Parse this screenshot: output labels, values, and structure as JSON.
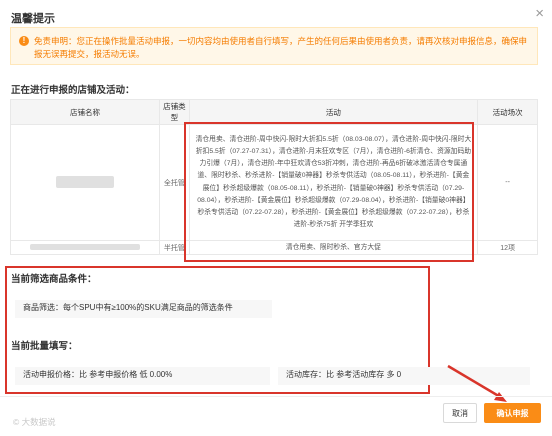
{
  "dialog": {
    "title": "温馨提示",
    "close_label": "×"
  },
  "warning": {
    "icon": "!",
    "text": "免责申明：您正在操作批量活动申报，一切内容均由使用者自行填写，产生的任何后果由使用者负责，请再次核对申报信息，确保申报无误再提交，报活动无误。"
  },
  "shops_section": {
    "title": "正在进行申报的店铺及活动："
  },
  "table": {
    "headers": [
      "店铺名称",
      "店铺类型",
      "活动",
      "活动场次"
    ],
    "rows": [
      {
        "type": "全托管",
        "activity": "清仓甩卖、清仓进阶-周中快闪-限时大折扣5.5折（08.03-08.07），清仓进阶-周中快闪-限时大折扣5.5折（07.27-07.31），清仓进阶-月末狂欢专区（7月），清仓进阶-6折清仓、资源加码助力引爆（7月），清仓进阶-年中狂欢清仓53折冲刺，清仓进阶-再品6折破冰激活清仓专属通道、限时秒杀、秒杀进阶-【销量破0神器】秒杀专供活动（08.05-08.11），秒杀进阶-【黄金展位】秒杀超级爆款（08.05-08.11），秒杀进阶-【销量破0神器】秒杀专供活动（07.29-08.04），秒杀进阶-【黄金展位】秒杀超级爆款（07.29-08.04），秒杀进阶-【销量破0神器】秒杀专供活动（07.22-07.28），秒杀进阶-【黄金展位】秒杀超级爆款（07.22-07.28），秒杀进阶-秒杀75折 开学季狂欢",
        "count": "--"
      },
      {
        "type": "半托管",
        "activity": "清仓甩卖、限时秒杀、官方大促",
        "count": "12项"
      }
    ]
  },
  "filter_section": {
    "title": "当前筛选商品条件：",
    "condition": "商品筛选：每个SPU中有≥100%的SKU满足商品的筛选条件"
  },
  "batch_section": {
    "title": "当前批量填写：",
    "price": "活动申报价格：比 参考申报价格 低 0.00%",
    "stock": "活动库存：比 参考活动库存 多 0"
  },
  "buttons": {
    "cancel": "取消",
    "confirm": "确认申报"
  },
  "watermark": "© 大数据说",
  "colors": {
    "accent": "#fa8c16",
    "highlight": "#d9352b"
  }
}
